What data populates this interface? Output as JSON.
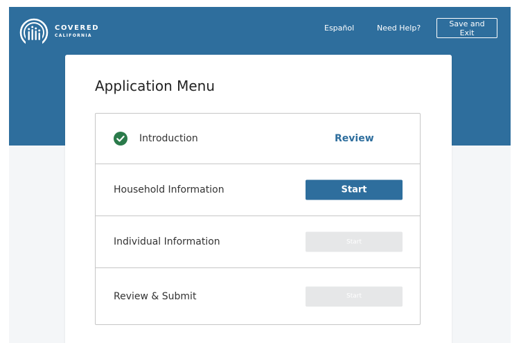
{
  "header": {
    "logo": {
      "line1": "COVERED",
      "line2": "CALIFORNIA"
    },
    "links": {
      "espanol": "Español",
      "need_help": "Need Help?"
    },
    "save_exit_label": "Save and Exit"
  },
  "main": {
    "title": "Application Menu",
    "steps": [
      {
        "label": "Introduction",
        "status": "complete",
        "action_label": "Review",
        "icon": "check-circle-icon"
      },
      {
        "label": "Household Information",
        "status": "available",
        "action_label": "Start"
      },
      {
        "label": "Individual Information",
        "status": "disabled",
        "action_label": "Start"
      },
      {
        "label": "Review & Submit",
        "status": "disabled",
        "action_label": "Start"
      }
    ]
  },
  "colors": {
    "brand_blue": "#2e6e9d",
    "complete_green": "#2a7a4a",
    "disabled_gray": "#e6e7e8"
  }
}
